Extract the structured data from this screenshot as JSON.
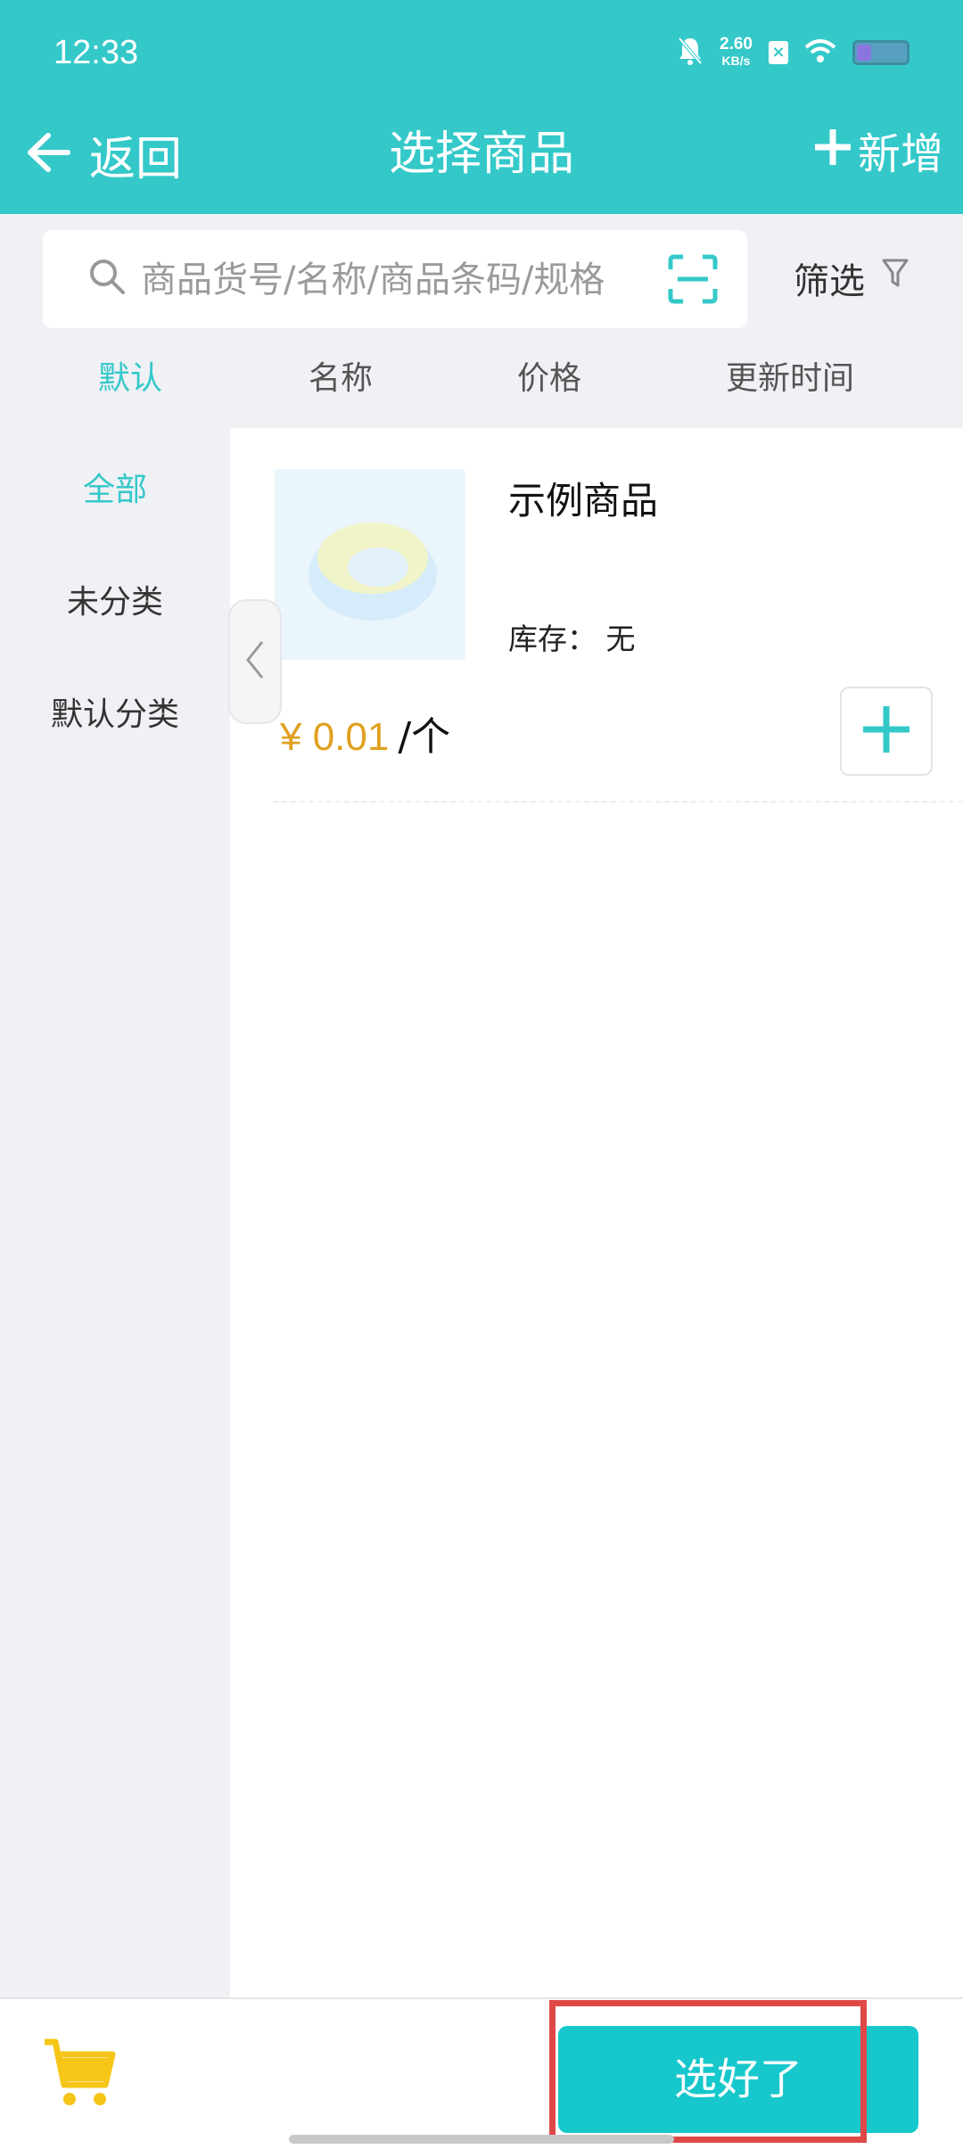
{
  "status_bar": {
    "time": "12:33",
    "net_speed_value": "2.60",
    "net_speed_unit": "KB/s",
    "battery_level": 0.3
  },
  "header": {
    "back_label": "返回",
    "title": "选择商品",
    "add_label": "新增"
  },
  "search": {
    "placeholder": "商品货号/名称/商品条码/规格",
    "filter_label": "筛选"
  },
  "sort_tabs": [
    {
      "label": "默认",
      "active": true
    },
    {
      "label": "名称",
      "active": false
    },
    {
      "label": "价格",
      "active": false
    },
    {
      "label": "更新时间",
      "active": false
    }
  ],
  "categories": [
    {
      "label": "全部",
      "active": true
    },
    {
      "label": "未分类",
      "active": false
    },
    {
      "label": "默认分类",
      "active": false
    }
  ],
  "products": [
    {
      "name": "示例商品",
      "stock_label": "库存：",
      "stock_value": "无",
      "price": "¥ 0.01",
      "unit": "/个"
    }
  ],
  "footer": {
    "confirm_label": "选好了"
  },
  "colors": {
    "accent": "#34c8c9",
    "price": "#e0a020",
    "highlight": "#e04848",
    "cart": "#f5c518"
  }
}
